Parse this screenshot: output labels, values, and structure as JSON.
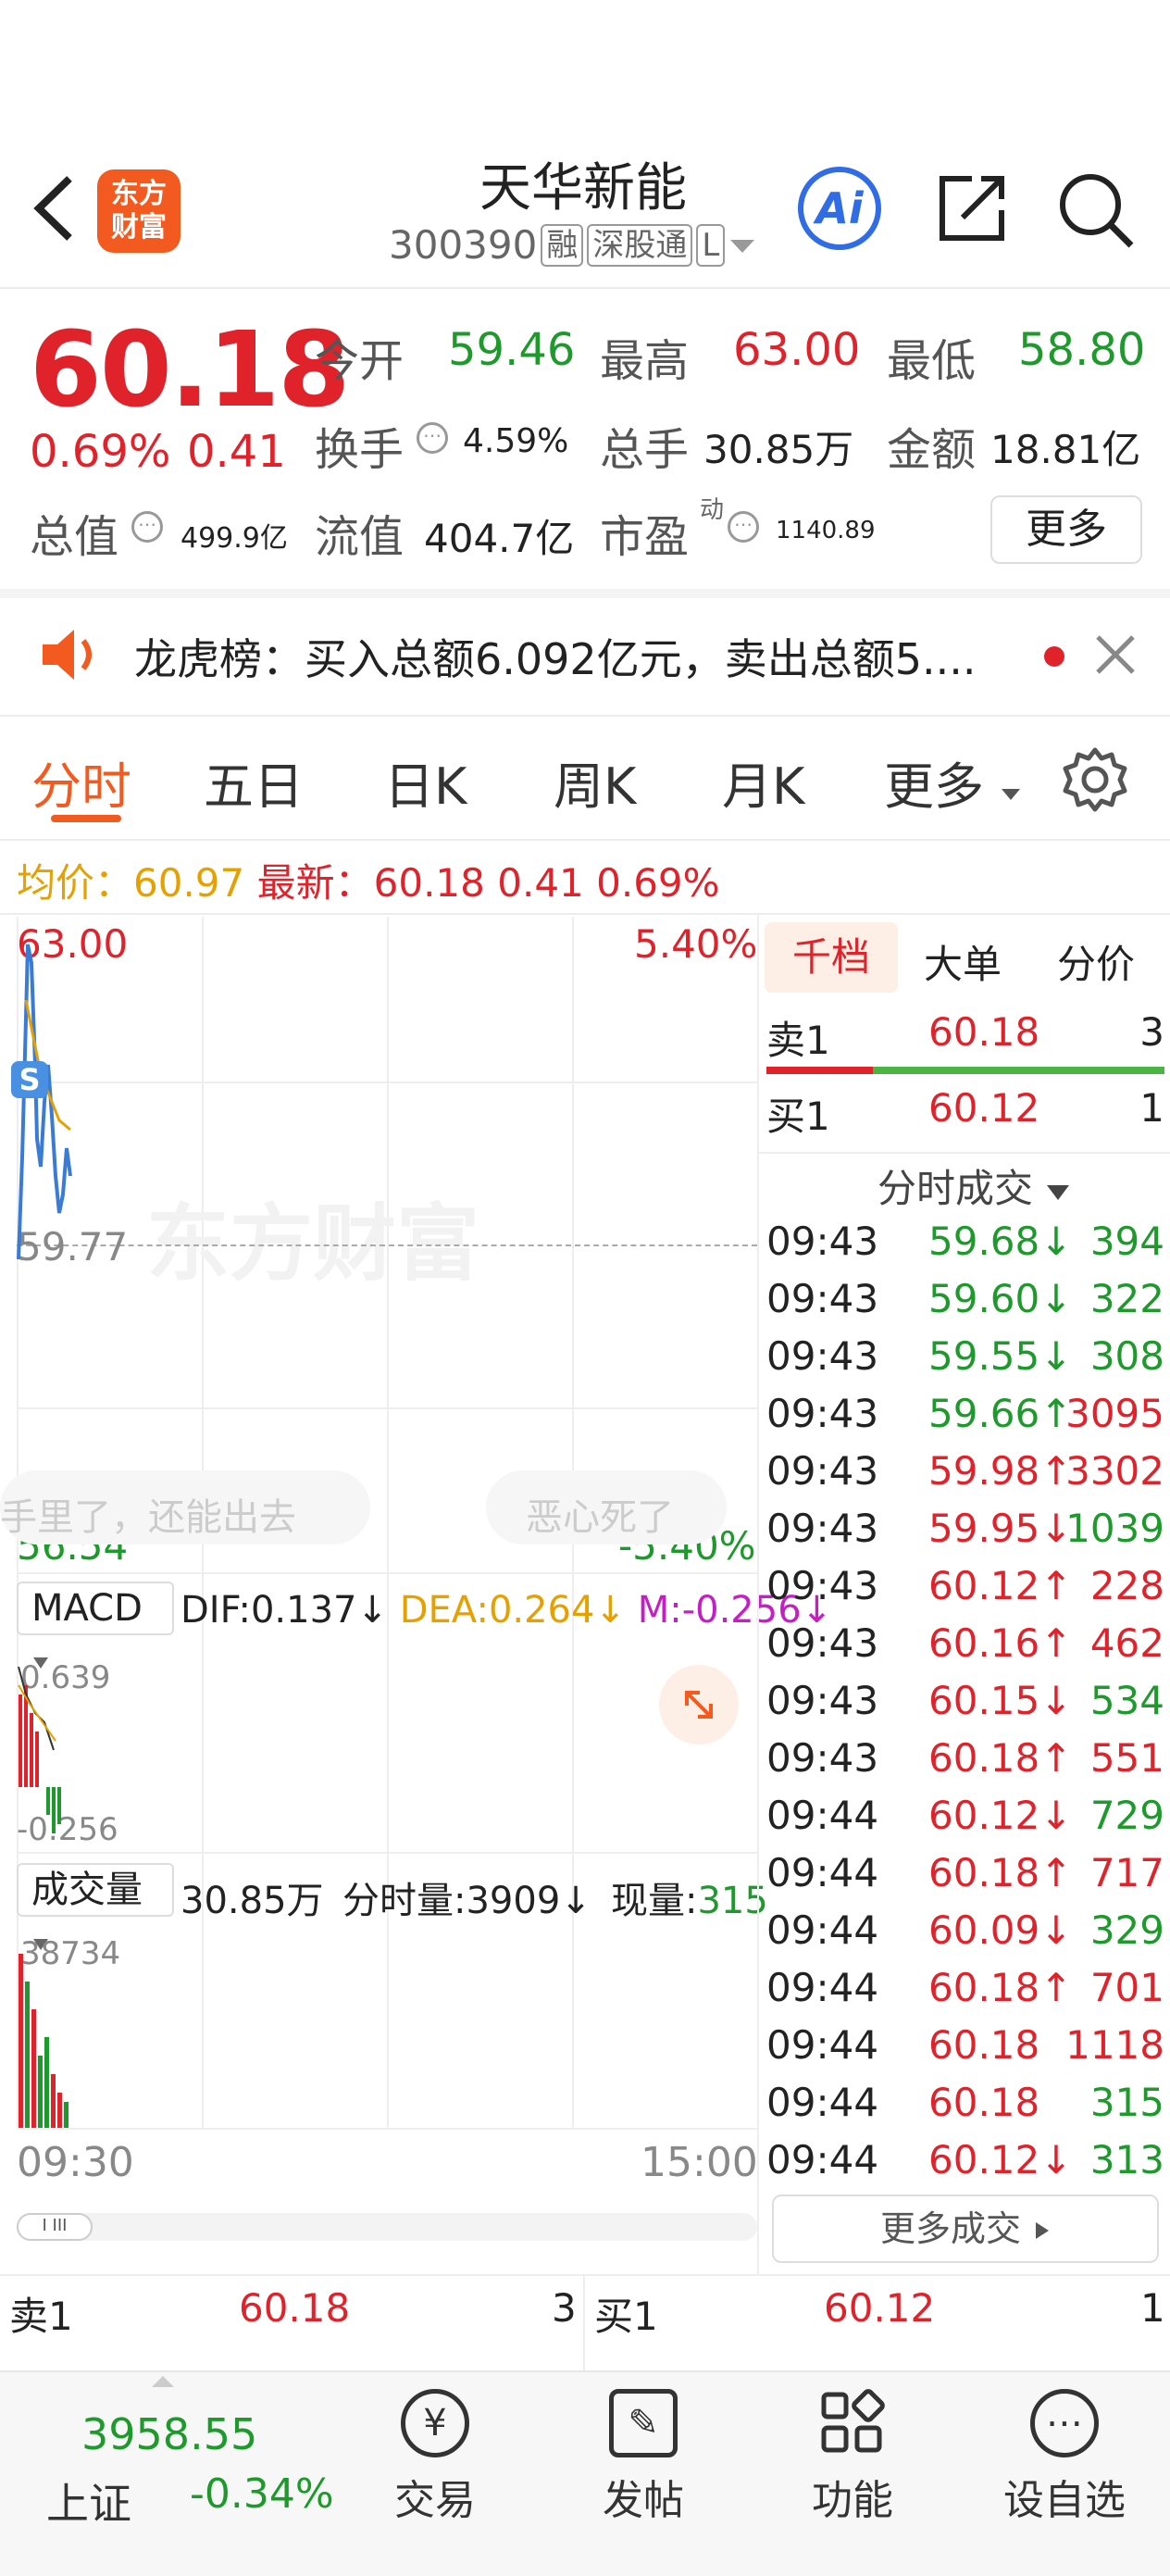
{
  "header": {
    "logo_line1": "东方",
    "logo_line2": "财富",
    "name": "天华新能",
    "code": "300390",
    "tags": [
      "融",
      "深股通",
      "L"
    ],
    "ai_label": "Ai"
  },
  "quote": {
    "price": "60.18",
    "change_pct": "0.69%",
    "change_amt": "0.41",
    "open_label": "今开",
    "open": "59.46",
    "high_label": "最高",
    "high": "63.00",
    "low_label": "最低",
    "low": "58.80",
    "turnover_label": "换手",
    "turnover": "4.59%",
    "volume_label": "总手",
    "volume": "30.85万",
    "amount_label": "金额",
    "amount": "18.81亿",
    "mktcap_label": "总值",
    "mktcap": "499.9亿",
    "float_label": "流值",
    "float": "404.7亿",
    "pe_label": "市盈",
    "pe_sup": "动",
    "pe": "1140.89",
    "more": "更多"
  },
  "notice": {
    "text": "龙虎榜：买入总额6.092亿元，卖出总额5...."
  },
  "tabs": [
    "分时",
    "五日",
    "日K",
    "周K",
    "月K",
    "更多"
  ],
  "stats": {
    "avg_label": "均价：",
    "avg": "60.97",
    "last_label": "最新：",
    "last": "60.18",
    "chg": "0.41",
    "pct": "0.69%"
  },
  "chart": {
    "y_high": "63.00",
    "y_high_pct": "5.40%",
    "y_mid": "59.77",
    "y_low": "56.54",
    "y_low_pct": "-5.40%",
    "watermark": "东方财富",
    "danmu1": "手里了，还能出去",
    "danmu2": "恶心死了",
    "s_badge": "S",
    "x_start": "09:30",
    "x_end": "15:00"
  },
  "macd": {
    "label": "MACD",
    "dif": "DIF:0.137↓",
    "dea": "DEA:0.264↓",
    "m": "M:-0.256↓",
    "top": "0.639",
    "bottom": "-0.256"
  },
  "vol": {
    "label": "成交量",
    "total": "30.85万",
    "minute": "分时量:3909↓",
    "now_label": "现量:",
    "now": "315",
    "top": "38734"
  },
  "panel": {
    "tabs": [
      "千档",
      "大单",
      "分价"
    ],
    "sell1_label": "卖1",
    "sell1_price": "60.18",
    "sell1_vol": "3",
    "buy1_label": "买1",
    "buy1_price": "60.12",
    "buy1_vol": "1",
    "ticks_title": "分时成交",
    "more_ticks": "更多成交",
    "ticks": [
      {
        "t": "09:43",
        "p": "59.68↓",
        "v": "394",
        "pc": "green",
        "vc": "green"
      },
      {
        "t": "09:43",
        "p": "59.60↓",
        "v": "322",
        "pc": "green",
        "vc": "green"
      },
      {
        "t": "09:43",
        "p": "59.55↓",
        "v": "308",
        "pc": "green",
        "vc": "green"
      },
      {
        "t": "09:43",
        "p": "59.66↑",
        "v": "3095",
        "pc": "green",
        "vc": "red"
      },
      {
        "t": "09:43",
        "p": "59.98↑",
        "v": "3302",
        "pc": "red",
        "vc": "red"
      },
      {
        "t": "09:43",
        "p": "59.95↓",
        "v": "1039",
        "pc": "red",
        "vc": "green"
      },
      {
        "t": "09:43",
        "p": "60.12↑",
        "v": "228",
        "pc": "red",
        "vc": "red"
      },
      {
        "t": "09:43",
        "p": "60.16↑",
        "v": "462",
        "pc": "red",
        "vc": "red"
      },
      {
        "t": "09:43",
        "p": "60.15↓",
        "v": "534",
        "pc": "red",
        "vc": "green"
      },
      {
        "t": "09:43",
        "p": "60.18↑",
        "v": "551",
        "pc": "red",
        "vc": "red"
      },
      {
        "t": "09:44",
        "p": "60.12↓",
        "v": "729",
        "pc": "red",
        "vc": "green"
      },
      {
        "t": "09:44",
        "p": "60.18↑",
        "v": "717",
        "pc": "red",
        "vc": "red"
      },
      {
        "t": "09:44",
        "p": "60.09↓",
        "v": "329",
        "pc": "red",
        "vc": "green"
      },
      {
        "t": "09:44",
        "p": "60.18↑",
        "v": "701",
        "pc": "red",
        "vc": "red"
      },
      {
        "t": "09:44",
        "p": "60.18",
        "v": "1118",
        "pc": "red",
        "vc": "red"
      },
      {
        "t": "09:44",
        "p": "60.18",
        "v": "315",
        "pc": "red",
        "vc": "green"
      },
      {
        "t": "09:44",
        "p": "60.12↓",
        "v": "313",
        "pc": "red",
        "vc": "green"
      }
    ]
  },
  "orderbook": {
    "sell1_label": "卖1",
    "sell1_price": "60.18",
    "sell1_vol": "3",
    "buy1_label": "买1",
    "buy1_price": "60.12",
    "buy1_vol": "1"
  },
  "bottom": {
    "index_value": "3958.55",
    "index_name": "上证",
    "index_pct": "-0.34%",
    "nav": [
      "交易",
      "发帖",
      "功能",
      "设自选"
    ]
  }
}
